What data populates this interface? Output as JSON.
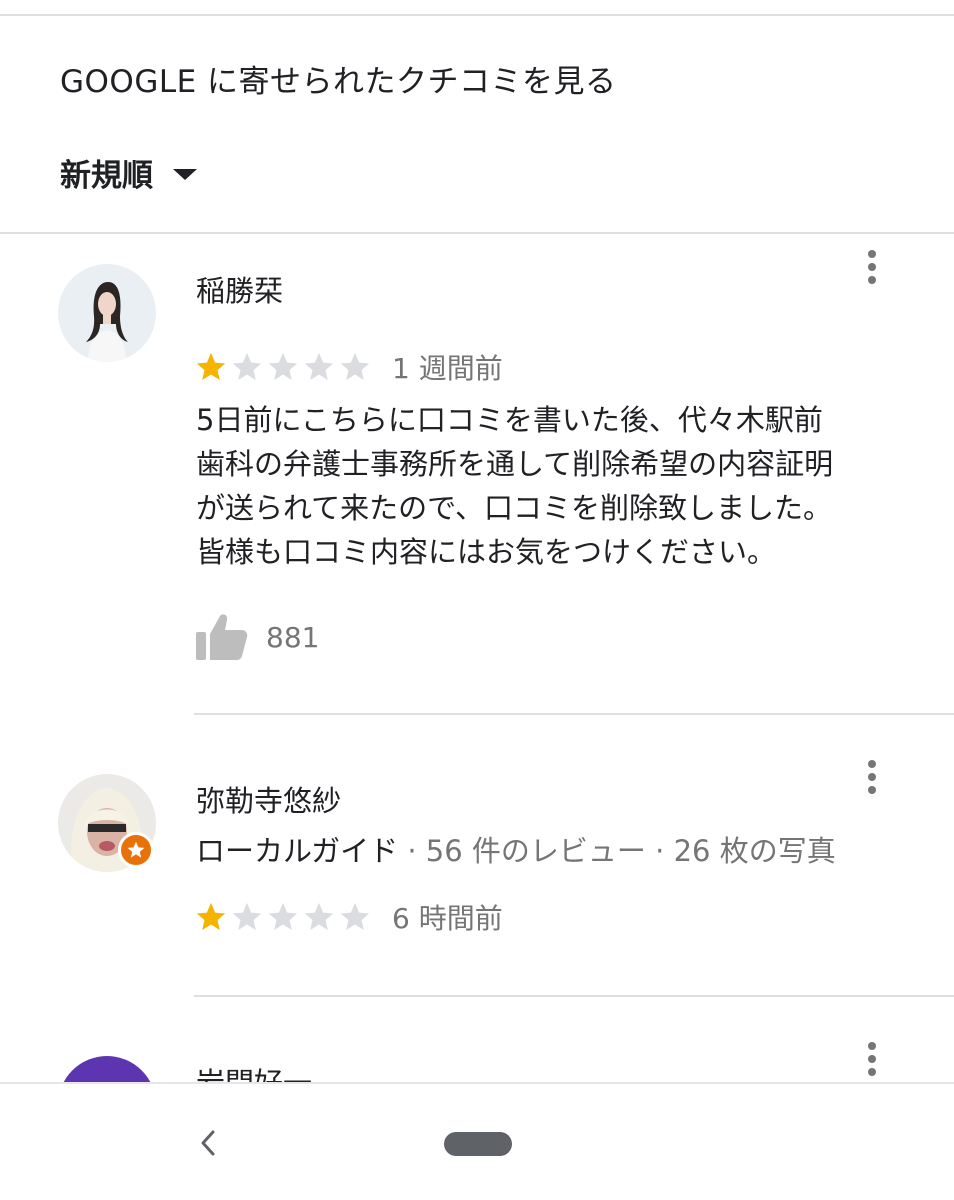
{
  "header": {
    "title": "GOOGLE に寄せられたクチコミを見る",
    "sort_label": "新規順"
  },
  "reviews": [
    {
      "author": "稲勝栞",
      "rating": 1,
      "max_rating": 5,
      "time": "1 週間前",
      "text": "5日前にこちらに口コミを書いた後、代々木駅前\n歯科の弁護士事務所を通して削除希望の内容証明\nが送られて来たので、口コミを削除致しました。\n皆様も口コミ内容にはお気をつけください。",
      "likes": "881"
    },
    {
      "author": "弥勒寺悠紗",
      "local_guide": "ローカルガイド",
      "review_count": "· 56 件のレビュー",
      "photo_count": "· 26 枚の写真",
      "rating": 1,
      "max_rating": 5,
      "time": "6 時間前"
    },
    {
      "author": "岩間好一"
    }
  ],
  "colors": {
    "star_filled": "#f4b400",
    "star_empty": "#dadce0",
    "local_guide_badge": "#e8710a",
    "avatar_third": "#5e35b1"
  },
  "icons": {
    "sort": "caret-down-icon",
    "more": "more-vert-icon",
    "like": "thumb-up-icon",
    "back": "chevron-left-icon",
    "home": "home-pill-icon"
  }
}
